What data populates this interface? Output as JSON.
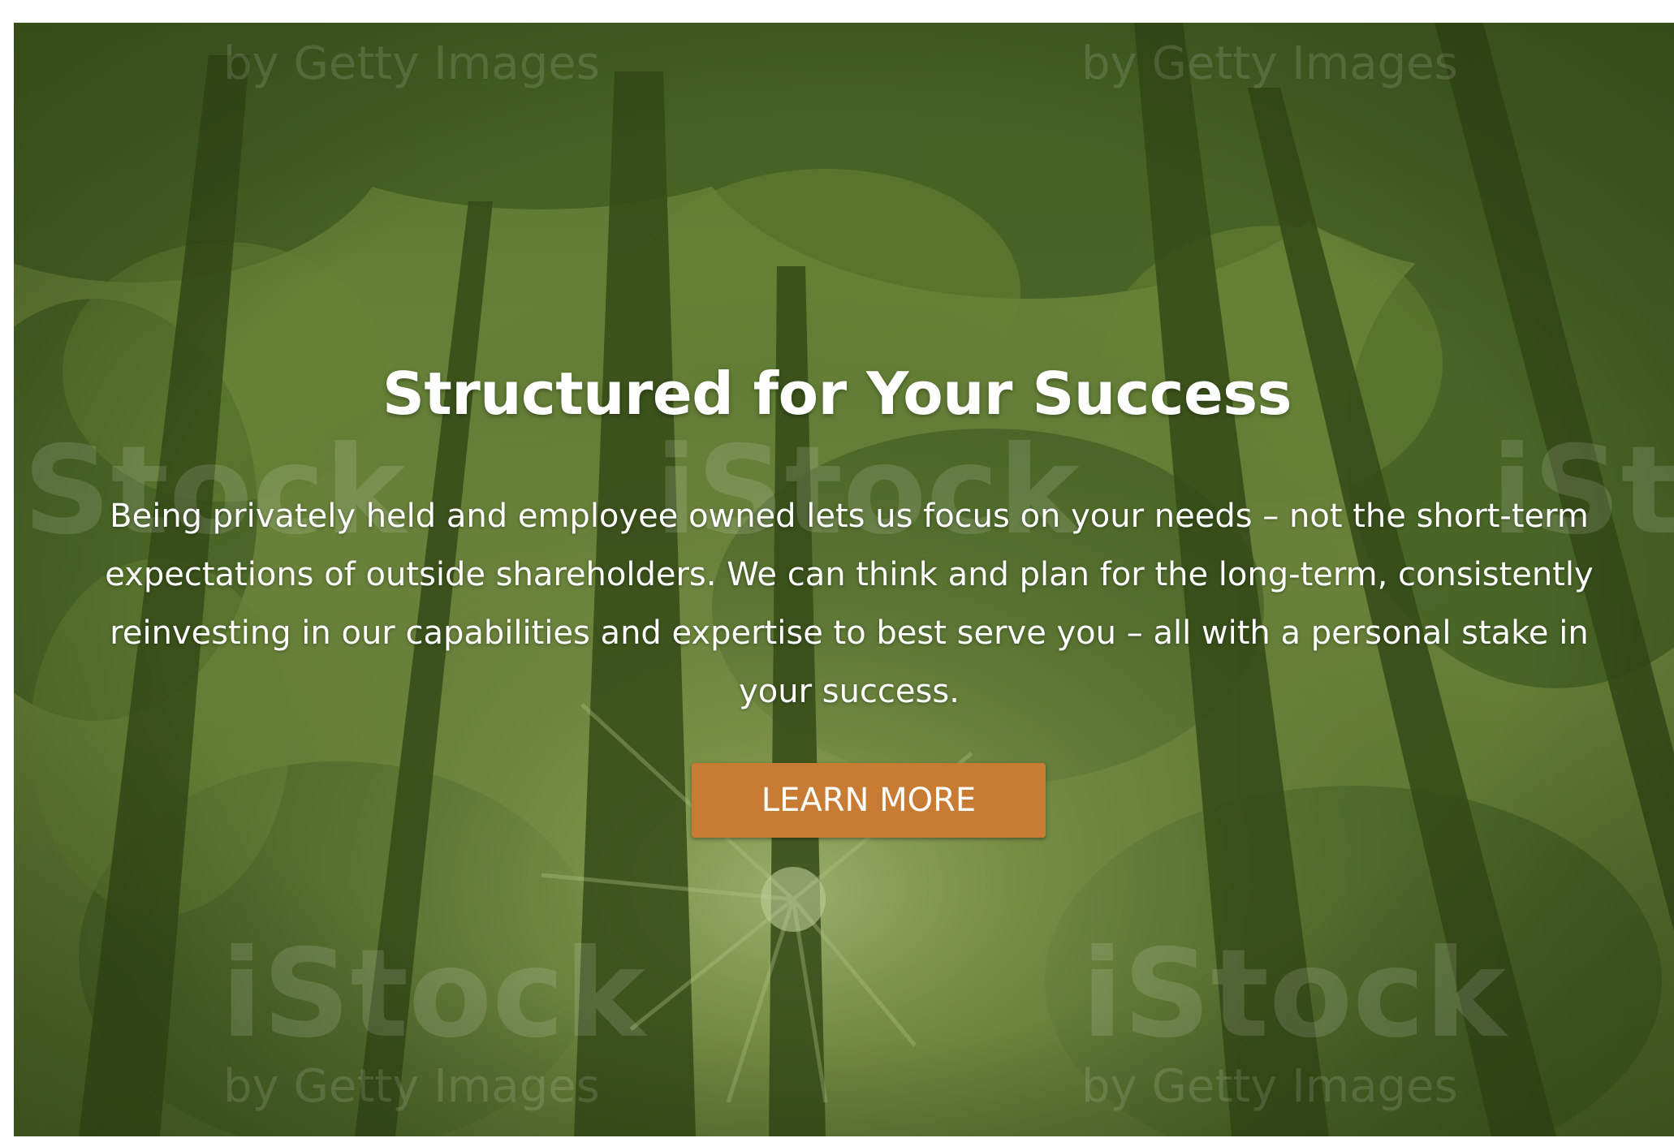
{
  "hero": {
    "title": "Structured for Your Success",
    "body": "Being privately held and employee owned lets us focus on your needs – not the short-term expectations of outside shareholders. We can think and plan for the long-term, consistently reinvesting in our capabilities and expertise to best serve you – all with a personal stake in your success.",
    "button_label": "LEARN MORE"
  },
  "watermark": {
    "brand": "iStock",
    "byline": "by Getty Images"
  },
  "colors": {
    "overlay_green": "#4f6a2c",
    "button_orange": "#c77b33",
    "text": "#ffffff"
  }
}
